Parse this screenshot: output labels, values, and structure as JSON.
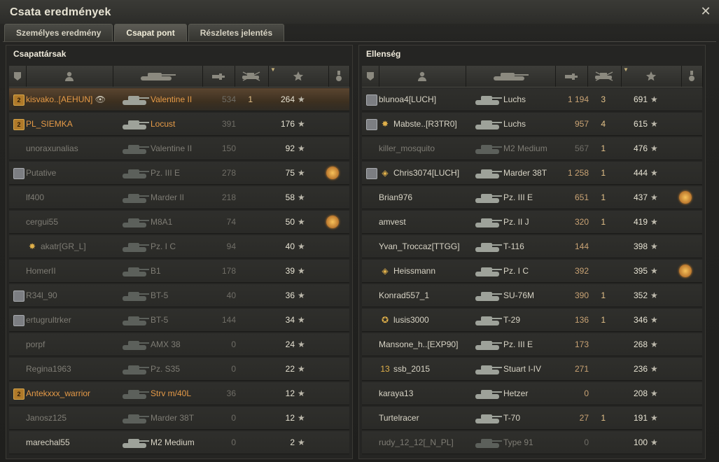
{
  "window": {
    "title": "Csata eredmények"
  },
  "tabs": [
    {
      "label": "Személyes eredmény",
      "active": false
    },
    {
      "label": "Csapat pont",
      "active": true
    },
    {
      "label": "Részletes jelentés",
      "active": false
    }
  ],
  "teams": {
    "allies": {
      "title": "Csapattársak",
      "rows": [
        {
          "rank": "gold",
          "icon": "",
          "name": "kisvako..[AEHUN]",
          "tank": "Valentine II",
          "dmg": "534",
          "kills": "1",
          "xp": "264",
          "medal": false,
          "self": true,
          "dead": false,
          "nameColor": "orange",
          "eye": true
        },
        {
          "rank": "gold",
          "icon": "",
          "name": "PL_SIEMKA",
          "tank": "Locust",
          "dmg": "391",
          "kills": "",
          "xp": "176",
          "medal": false,
          "self": false,
          "dead": false,
          "nameColor": "orange"
        },
        {
          "rank": "",
          "icon": "",
          "name": "unoraxunalias",
          "tank": "Valentine II",
          "dmg": "150",
          "kills": "",
          "xp": "92",
          "medal": false,
          "self": false,
          "dead": true
        },
        {
          "rank": "silver",
          "icon": "",
          "name": "Putative",
          "tank": "Pz. III E",
          "dmg": "278",
          "kills": "",
          "xp": "75",
          "medal": true,
          "self": false,
          "dead": true
        },
        {
          "rank": "",
          "icon": "",
          "name": "lf400",
          "tank": "Marder II",
          "dmg": "218",
          "kills": "",
          "xp": "58",
          "medal": false,
          "self": false,
          "dead": true
        },
        {
          "rank": "",
          "icon": "",
          "name": "cergui55",
          "tank": "M8A1",
          "dmg": "74",
          "kills": "",
          "xp": "50",
          "medal": true,
          "self": false,
          "dead": true
        },
        {
          "rank": "",
          "icon": "star",
          "name": "akatr[GR_L]",
          "tank": "Pz. I C",
          "dmg": "94",
          "kills": "",
          "xp": "40",
          "medal": false,
          "self": false,
          "dead": true
        },
        {
          "rank": "",
          "icon": "",
          "name": "HomerII",
          "tank": "B1",
          "dmg": "178",
          "kills": "",
          "xp": "39",
          "medal": false,
          "self": false,
          "dead": true
        },
        {
          "rank": "silver",
          "icon": "",
          "name": "R34l_90",
          "tank": "BT-5",
          "dmg": "40",
          "kills": "",
          "xp": "36",
          "medal": false,
          "self": false,
          "dead": true
        },
        {
          "rank": "silver",
          "icon": "",
          "name": "ertugrultrker",
          "tank": "BT-5",
          "dmg": "144",
          "kills": "",
          "xp": "34",
          "medal": false,
          "self": false,
          "dead": true
        },
        {
          "rank": "",
          "icon": "",
          "name": "porpf",
          "tank": "AMX 38",
          "dmg": "0",
          "kills": "",
          "xp": "24",
          "medal": false,
          "self": false,
          "dead": true
        },
        {
          "rank": "",
          "icon": "",
          "name": "Regina1963",
          "tank": "Pz. S35",
          "dmg": "0",
          "kills": "",
          "xp": "22",
          "medal": false,
          "self": false,
          "dead": true
        },
        {
          "rank": "gold",
          "icon": "",
          "name": "Antekxxx_warrior",
          "tank": "Strv m/40L",
          "dmg": "36",
          "kills": "",
          "xp": "12",
          "medal": false,
          "self": false,
          "dead": true,
          "nameColor": "orange"
        },
        {
          "rank": "",
          "icon": "",
          "name": "Janosz125",
          "tank": "Marder 38T",
          "dmg": "0",
          "kills": "",
          "xp": "12",
          "medal": false,
          "self": false,
          "dead": true
        },
        {
          "rank": "",
          "icon": "",
          "name": "marechal55",
          "tank": "M2 Medium",
          "dmg": "0",
          "kills": "",
          "xp": "2",
          "medal": false,
          "self": false,
          "dead": false
        }
      ]
    },
    "enemies": {
      "title": "Ellenség",
      "rows": [
        {
          "rank": "silver",
          "icon": "",
          "name": "blunoa4[LUCH]",
          "tank": "Luchs",
          "dmg": "1 194",
          "kills": "3",
          "xp": "691",
          "medal": false,
          "dead": false
        },
        {
          "rank": "silver",
          "icon": "star",
          "name": "Mabste..[R3TR0]",
          "tank": "Luchs",
          "dmg": "957",
          "kills": "4",
          "xp": "615",
          "medal": false,
          "dead": false
        },
        {
          "rank": "",
          "icon": "",
          "name": "killer_mosquito",
          "tank": "M2 Medium",
          "dmg": "567",
          "kills": "1",
          "xp": "476",
          "medal": false,
          "dead": true
        },
        {
          "rank": "silver",
          "icon": "diamond",
          "name": "Chris3074[LUCH]",
          "tank": "Marder 38T",
          "dmg": "1 258",
          "kills": "1",
          "xp": "444",
          "medal": false,
          "dead": false
        },
        {
          "rank": "",
          "icon": "",
          "name": "Brian976",
          "tank": "Pz. III E",
          "dmg": "651",
          "kills": "1",
          "xp": "437",
          "medal": true,
          "dead": false
        },
        {
          "rank": "",
          "icon": "",
          "name": "amvest",
          "tank": "Pz. II J",
          "dmg": "320",
          "kills": "1",
          "xp": "419",
          "medal": false,
          "dead": false
        },
        {
          "rank": "",
          "icon": "",
          "name": "Yvan_Troccaz[TTGG]",
          "tank": "T-116",
          "dmg": "144",
          "kills": "",
          "xp": "398",
          "medal": false,
          "dead": false
        },
        {
          "rank": "",
          "icon": "diamond",
          "name": "Heissmann",
          "tank": "Pz. I C",
          "dmg": "392",
          "kills": "",
          "xp": "395",
          "medal": true,
          "dead": false
        },
        {
          "rank": "",
          "icon": "",
          "name": "Konrad557_1",
          "tank": "SU-76M",
          "dmg": "390",
          "kills": "1",
          "xp": "352",
          "medal": false,
          "dead": false
        },
        {
          "rank": "",
          "icon": "wreath",
          "name": "lusis3000",
          "tank": "T-29",
          "dmg": "136",
          "kills": "1",
          "xp": "346",
          "medal": false,
          "dead": false
        },
        {
          "rank": "",
          "icon": "",
          "name": "Mansone_h..[EXP90]",
          "tank": "Pz. III E",
          "dmg": "173",
          "kills": "",
          "xp": "268",
          "medal": false,
          "dead": false
        },
        {
          "rank": "",
          "icon": "badge13",
          "name": "ssb_2015",
          "tank": "Stuart I-IV",
          "dmg": "271",
          "kills": "",
          "xp": "236",
          "medal": false,
          "dead": false
        },
        {
          "rank": "",
          "icon": "",
          "name": "karaya13",
          "tank": "Hetzer",
          "dmg": "0",
          "kills": "",
          "xp": "208",
          "medal": false,
          "dead": false
        },
        {
          "rank": "",
          "icon": "",
          "name": "Turtelracer",
          "tank": "T-70",
          "dmg": "27",
          "kills": "1",
          "xp": "191",
          "medal": false,
          "dead": false
        },
        {
          "rank": "",
          "icon": "",
          "name": "rudy_12_12[_N_PL]",
          "tank": "Type 91",
          "dmg": "0",
          "kills": "",
          "xp": "100",
          "medal": false,
          "dead": true
        }
      ]
    }
  },
  "icons": {
    "columns": [
      "squad-icon",
      "player-icon",
      "tank-icon",
      "damage-icon",
      "kills-icon",
      "xp-star-icon",
      "medal-icon"
    ],
    "star_glyph": "★"
  }
}
